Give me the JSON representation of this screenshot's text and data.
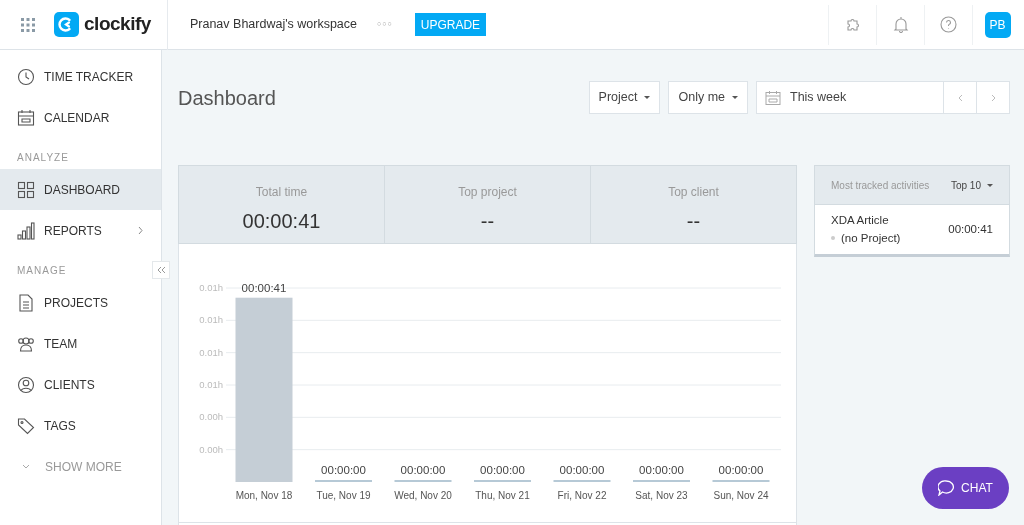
{
  "header": {
    "logo": "clockify",
    "workspace": "Pranav Bhardwaj's workspace",
    "more": "○○○",
    "upgrade": "UPGRADE",
    "avatar": "PB"
  },
  "sidebar": {
    "sections": [
      {
        "items": [
          {
            "label": "TIME TRACKER",
            "selected": false,
            "expandable": false
          },
          {
            "label": "CALENDAR",
            "selected": false,
            "expandable": false
          }
        ]
      },
      {
        "heading": "ANALYZE",
        "items": [
          {
            "label": "DASHBOARD",
            "selected": true,
            "expandable": false
          },
          {
            "label": "REPORTS",
            "selected": false,
            "expandable": true
          }
        ]
      },
      {
        "heading": "MANAGE",
        "items": [
          {
            "label": "PROJECTS",
            "selected": false,
            "expandable": false
          },
          {
            "label": "TEAM",
            "selected": false,
            "expandable": false
          },
          {
            "label": "CLIENTS",
            "selected": false,
            "expandable": false
          },
          {
            "label": "TAGS",
            "selected": false,
            "expandable": false
          }
        ]
      }
    ],
    "show_more": "SHOW MORE"
  },
  "page": {
    "title": "Dashboard",
    "filters": [
      "Project",
      "Only me"
    ],
    "date_range": "This week"
  },
  "summary": [
    {
      "label": "Total time",
      "value": "00:00:41"
    },
    {
      "label": "Top project",
      "value": "--"
    },
    {
      "label": "Top client",
      "value": "--"
    }
  ],
  "chart": {
    "chart_data": {
      "type": "bar",
      "categories": [
        "Mon, Nov 18",
        "Tue, Nov 19",
        "Wed, Nov 20",
        "Thu, Nov 21",
        "Fri, Nov 22",
        "Sat, Nov 23",
        "Sun, Nov 24"
      ],
      "values": [
        0.0114,
        0,
        0,
        0,
        0,
        0,
        0
      ],
      "value_labels": [
        "00:00:41",
        "00:00:00",
        "00:00:00",
        "00:00:00",
        "00:00:00",
        "00:00:00",
        "00:00:00"
      ],
      "ylim": [
        0,
        0.012
      ],
      "grid": true,
      "yticks": [
        {
          "value": 0.012,
          "label": "0.01h"
        },
        {
          "value": 0.01,
          "label": "0.01h"
        },
        {
          "value": 0.008,
          "label": "0.01h"
        },
        {
          "value": 0.006,
          "label": "0.01h"
        },
        {
          "value": 0.004,
          "label": "0.00h"
        },
        {
          "value": 0.002,
          "label": "0.00h"
        }
      ]
    }
  },
  "activities": {
    "title": "Most tracked activities",
    "limit": "Top 10",
    "rows": [
      {
        "name": "XDA Article",
        "project": "(no Project)",
        "time": "00:00:41"
      }
    ]
  },
  "chat": "CHAT"
}
